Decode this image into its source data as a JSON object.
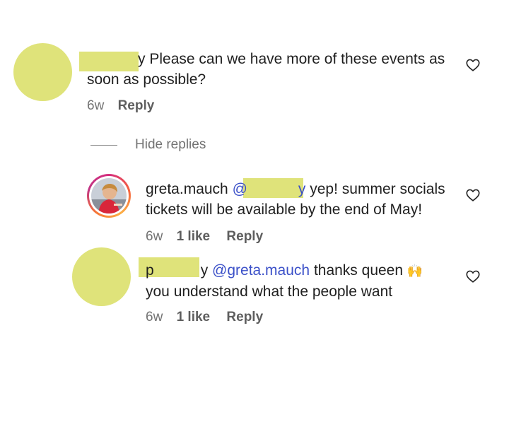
{
  "comments": [
    {
      "tail": "y",
      "text": "Please can we have more of these events as",
      "text2": "soon as possible?",
      "time": "6w",
      "reply": "Reply"
    }
  ],
  "hide_replies": "Hide replies",
  "reply1": {
    "username": "greta.mauch",
    "mention_start": "@",
    "mention_tail": "y",
    "text": "yep! summer socials",
    "text2": "tickets will be available by the end of May!",
    "time": "6w",
    "likes": "1 like",
    "reply": "Reply"
  },
  "reply2": {
    "user_head": "p",
    "user_tail": "y",
    "mention": "@greta.mauch",
    "text": "thanks queen",
    "emoji": "🙌",
    "text2": "you understand what the people want",
    "time": "6w",
    "likes": "1 like",
    "reply": "Reply"
  },
  "colors": {
    "redaction": "#dfe37a",
    "mention": "#3b50c8",
    "meta": "#737373"
  },
  "icons": {
    "like": "heart-outline-icon"
  }
}
